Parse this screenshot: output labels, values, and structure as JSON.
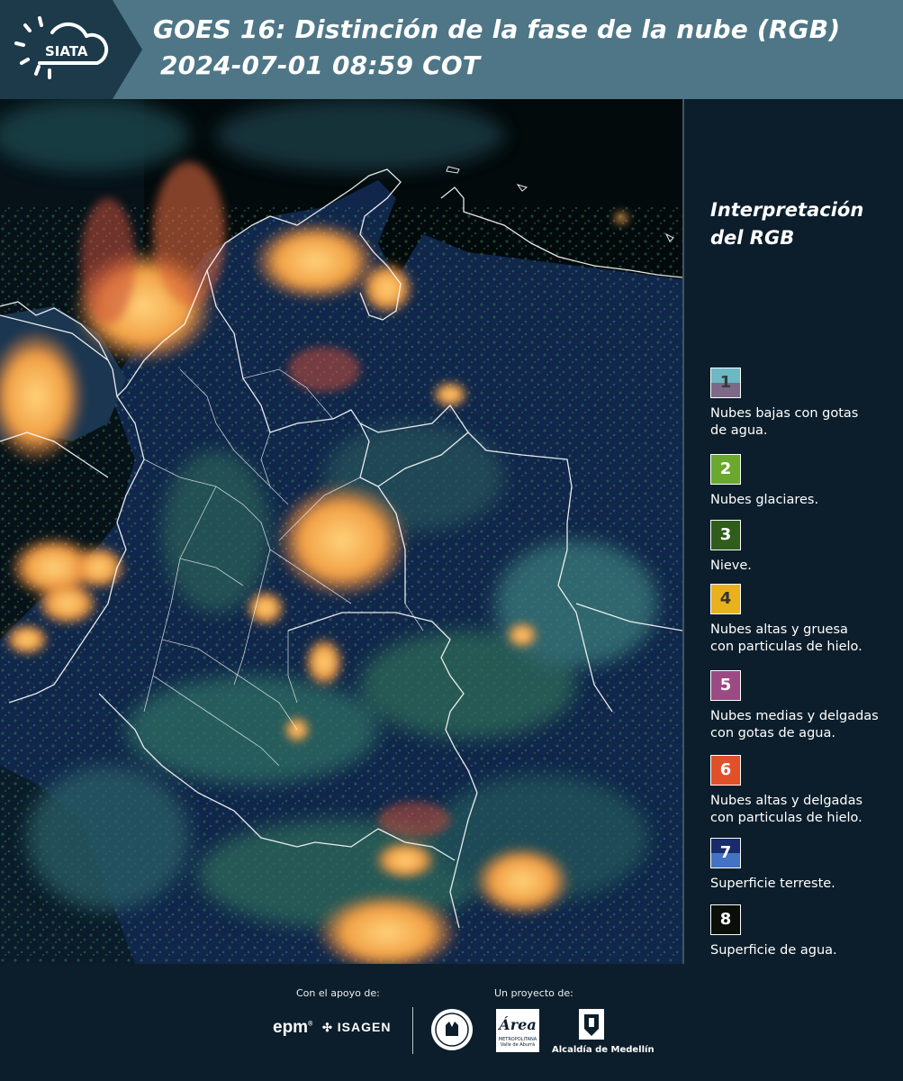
{
  "header": {
    "logo_text": "SIATA",
    "title_line1": "GOES 16: Distinción de la fase de la nube (RGB)",
    "title_line2": "2024-07-01 08:59 COT",
    "background_color": "#4e7686"
  },
  "legend": {
    "title_line1": "Interpretación",
    "title_line2": "del RGB",
    "items": [
      {
        "number": "1",
        "label_line1": "Nubes bajas con gotas",
        "label_line2": "de agua.",
        "color_top": "#6cb8c5",
        "color_bottom": "#7c6a88",
        "num_color": "#3a3a3a"
      },
      {
        "number": "2",
        "label_line1": "Nubes glaciares.",
        "label_line2": "",
        "color_top": "#6aa82e",
        "color_bottom": "#6aa82e",
        "num_color": "#ffffff"
      },
      {
        "number": "3",
        "label_line1": "Nieve.",
        "label_line2": "",
        "color_top": "#2f5d1c",
        "color_bottom": "#2f5d1c",
        "num_color": "#ffffff"
      },
      {
        "number": "4",
        "label_line1": "Nubes altas y gruesa",
        "label_line2": "con particulas de hielo.",
        "color_top": "#e9b11b",
        "color_bottom": "#e9b11b",
        "num_color": "#333333"
      },
      {
        "number": "5",
        "label_line1": "Nubes medias y delgadas",
        "label_line2": "con gotas de agua.",
        "color_top": "#9c4a84",
        "color_bottom": "#9c4a84",
        "num_color": "#ffffff"
      },
      {
        "number": "6",
        "label_line1": "Nubes altas y delgadas",
        "label_line2": "con particulas de hielo.",
        "color_top": "#e2502a",
        "color_bottom": "#e2502a",
        "num_color": "#ffffff"
      },
      {
        "number": "7",
        "label_line1": "Superficie terreste.",
        "label_line2": "",
        "color_top": "#1a2b6b",
        "color_bottom": "#4472c4",
        "num_color": "#ffffff"
      },
      {
        "number": "8",
        "label_line1": "Superficie de agua.",
        "label_line2": "",
        "color_top": "#0a0f0a",
        "color_bottom": "#0a0f0a",
        "num_color": "#ffffff"
      }
    ]
  },
  "footer": {
    "support_label": "Con el apoyo de:",
    "project_label": "Un proyecto de:",
    "sponsor1": "epm",
    "sponsor2": "ISAGEN",
    "partner1": "Área",
    "partner1_sub1": "METROPOLITANA",
    "partner1_sub2": "Valle de Aburrá",
    "partner2": "Alcaldía de Medellín"
  },
  "map": {
    "water_color": "#040c10",
    "land_color": "#10264a",
    "cloud_color": "#f5b24a",
    "border_color": "#ffffff"
  }
}
